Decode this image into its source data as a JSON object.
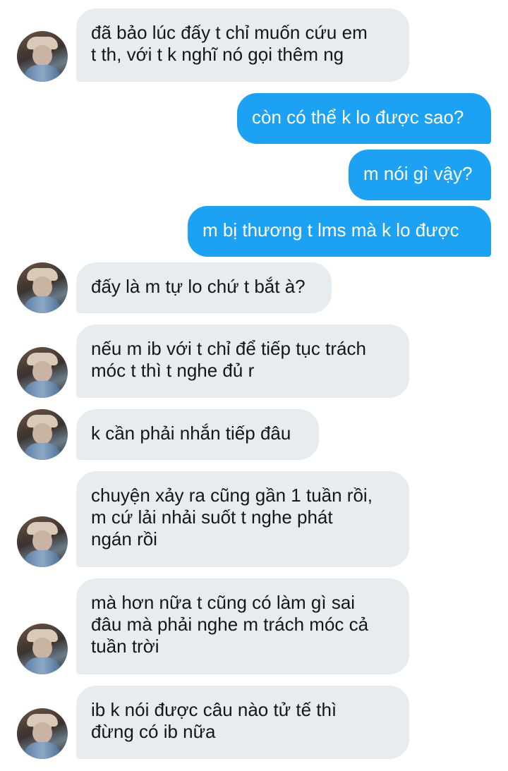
{
  "conversation": {
    "messages": [
      {
        "direction": "in",
        "text": "đã bảo lúc đấy t chỉ muốn cứu em\nt th, với t k nghĩ nó gọi thêm ng"
      },
      {
        "direction": "out",
        "text": "còn có thể k lo được sao?"
      },
      {
        "direction": "out",
        "text": "m nói gì vậy?"
      },
      {
        "direction": "out",
        "text": "m bị thương t lms mà k lo được"
      },
      {
        "direction": "in",
        "text": "đấy là m tự lo chứ t bắt à?"
      },
      {
        "direction": "in",
        "text": "nếu m ib với t chỉ để tiếp tục trách\nmóc t thì t nghe đủ r"
      },
      {
        "direction": "in",
        "text": "k cần phải nhắn tiếp đâu"
      },
      {
        "direction": "in",
        "text": "chuyện xảy ra cũng gần 1 tuần rồi,\nm cứ lải nhải suốt t nghe phát\nngán rồi"
      },
      {
        "direction": "in",
        "text": "mà hơn nữa t cũng có làm gì sai\nđâu mà phải nghe m trách móc cả\ntuần trời"
      },
      {
        "direction": "in",
        "text": "ib k nói được câu nào tử tế thì\nđừng có ib nữa"
      }
    ]
  },
  "colors": {
    "incoming_bubble": "#e6ecf0",
    "outgoing_bubble": "#1da1f2",
    "incoming_text": "#14171a",
    "outgoing_text": "#ffffff"
  },
  "icons": {
    "avatar": "user-avatar-photo"
  }
}
